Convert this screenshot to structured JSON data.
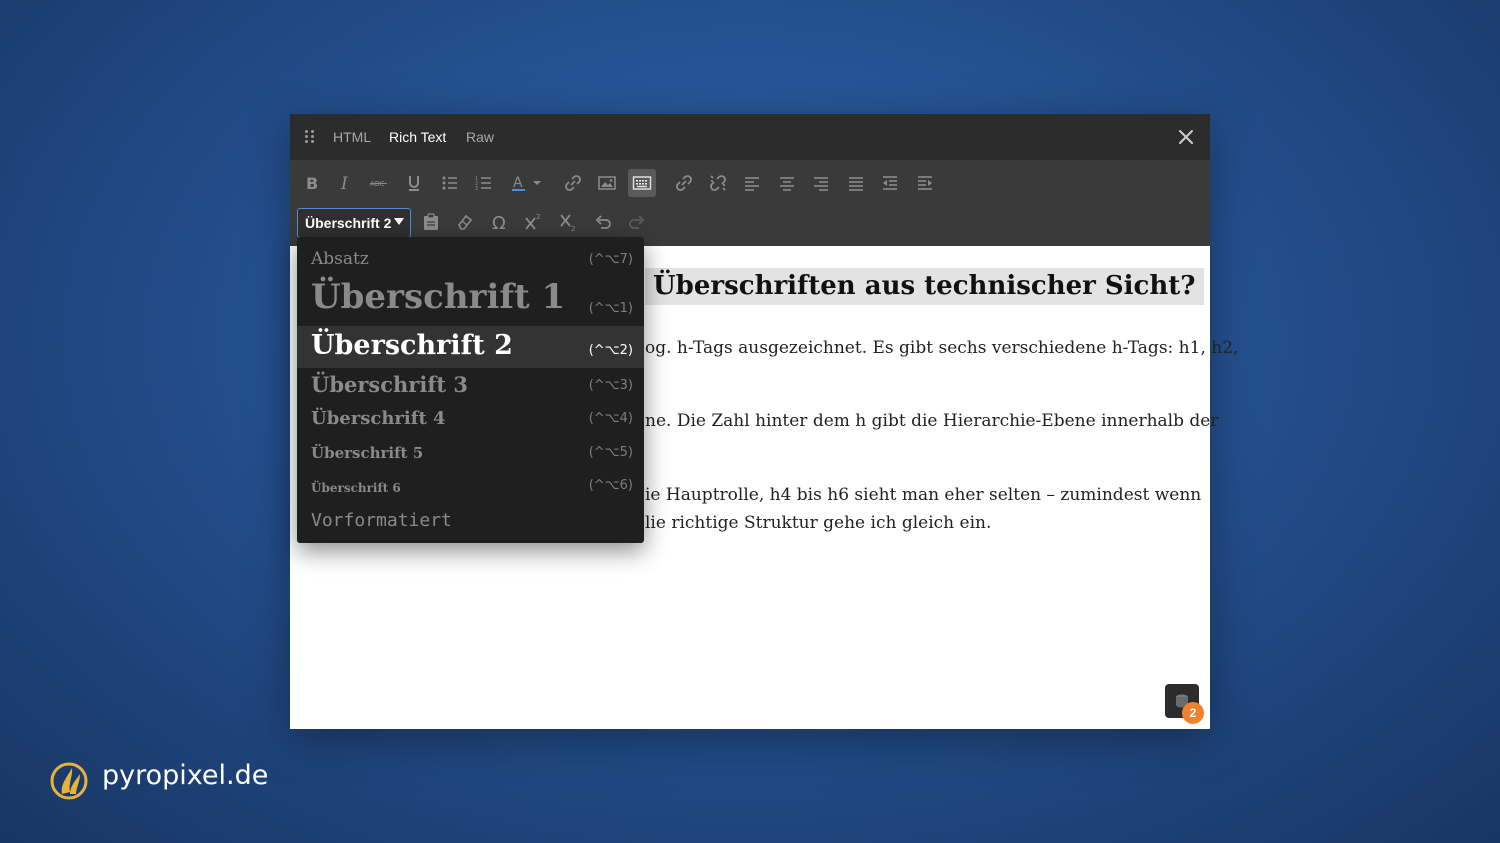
{
  "tabs": [
    {
      "label": "HTML"
    },
    {
      "label": "Rich Text"
    },
    {
      "label": "Raw"
    }
  ],
  "active_tab": "Rich Text",
  "format_select": {
    "value": "Überschrift 2"
  },
  "format_menu": [
    {
      "label": "Absatz",
      "shortcut": "(^⌥7)"
    },
    {
      "label": "Überschrift 1",
      "shortcut": "(^⌥1)"
    },
    {
      "label": "Überschrift 2",
      "shortcut": "(^⌥2)"
    },
    {
      "label": "Überschrift 3",
      "shortcut": "(^⌥3)"
    },
    {
      "label": "Überschrift 4",
      "shortcut": "(^⌥4)"
    },
    {
      "label": "Überschrift 5",
      "shortcut": "(^⌥5)"
    },
    {
      "label": "Überschrift 6",
      "shortcut": "(^⌥6)"
    },
    {
      "label": "Vorformatiert",
      "shortcut": ""
    }
  ],
  "selected_format": "Überschrift 2",
  "content": {
    "heading": "Überschriften aus technischer Sicht?",
    "lines": [
      "og. h-Tags ausgezeichnet. Es gibt sechs verschiedene h-Tags: h1, h2,",
      "ne. Die Zahl hinter dem h gibt die Hierarchie-Ebene innerhalb der",
      "ie Hauptrolle, h4 bis h6 sieht man eher selten – zumindest wenn",
      "lie richtige Struktur gehe ich gleich ein."
    ]
  },
  "notification_count": "2",
  "brand": {
    "name": "pyropixel.de",
    "accent": "#e8b33c"
  },
  "colors": {
    "toolbar": "#3a3a3a",
    "titlebar": "#2c2c2c",
    "badge": "#f0812f",
    "select_border": "#4a90d9"
  }
}
